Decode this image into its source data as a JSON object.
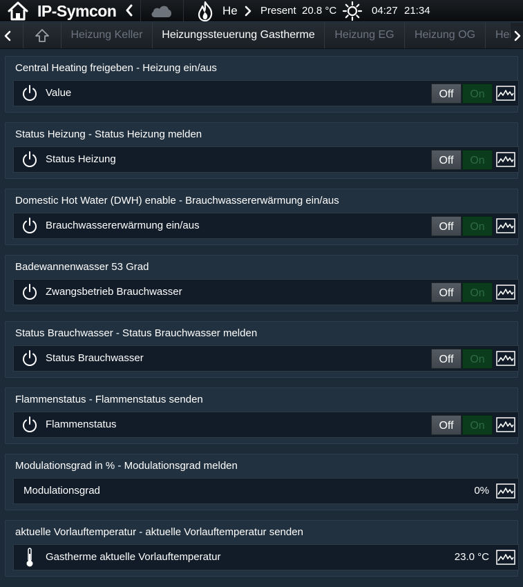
{
  "header": {
    "app_title": "IP-Symcon",
    "he_text": "He",
    "presence": "Present",
    "temperature": "20.8 °C",
    "sunrise": "04:27",
    "clock": "21:34"
  },
  "tabs": {
    "items": [
      {
        "label": "Heizung Keller",
        "active": false
      },
      {
        "label": "Heizungssteuerung Gastherme",
        "active": true
      },
      {
        "label": "Heizung EG",
        "active": false
      },
      {
        "label": "Heizung OG",
        "active": false
      },
      {
        "label": "Hei",
        "active": false
      }
    ]
  },
  "panels": [
    {
      "title": "Central Heating freigeben - Heizung ein/aus",
      "label": "Value",
      "icon": "power-icon",
      "control": "switch",
      "off_label": "Off",
      "on_label": "On"
    },
    {
      "title": "Status Heizung - Status Heizung melden",
      "label": "Status Heizung",
      "icon": "power-icon",
      "control": "switch",
      "off_label": "Off",
      "on_label": "On"
    },
    {
      "title": "Domestic Hot Water (DWH) enable - Brauchwassererwärmung ein/aus",
      "label": "Brauchwassererwärmung ein/aus",
      "icon": "power-icon",
      "control": "switch",
      "off_label": "Off",
      "on_label": "On"
    },
    {
      "title": "Badewannenwasser 53 Grad",
      "label": "Zwangsbetrieb Brauchwasser",
      "icon": "power-icon",
      "control": "switch",
      "off_label": "Off",
      "on_label": "On"
    },
    {
      "title": "Status Brauchwasser - Status Brauchwasser melden",
      "label": "Status Brauchwasser",
      "icon": "power-icon",
      "control": "switch",
      "off_label": "Off",
      "on_label": "On"
    },
    {
      "title": "Flammenstatus - Flammenstatus senden",
      "label": "Flammenstatus",
      "icon": "power-icon",
      "control": "switch",
      "off_label": "Off",
      "on_label": "On"
    },
    {
      "title": "Modulationsgrad in % - Modulationsgrad melden",
      "label": "Modulationsgrad",
      "icon": "",
      "control": "value",
      "value": "0%"
    },
    {
      "title": "aktuelle Vorlauftemperatur - aktuelle Vorlauftemperatur senden",
      "label": "Gastherme aktuelle Vorlauftemperatur",
      "icon": "thermometer-icon",
      "control": "value",
      "value": "23.0 °C"
    }
  ],
  "colors": {
    "background": "#1d2b39",
    "panel": "#223140",
    "row": "#111c28",
    "on_active": "#0b3c1c",
    "tab_inactive": "#6b7480"
  }
}
